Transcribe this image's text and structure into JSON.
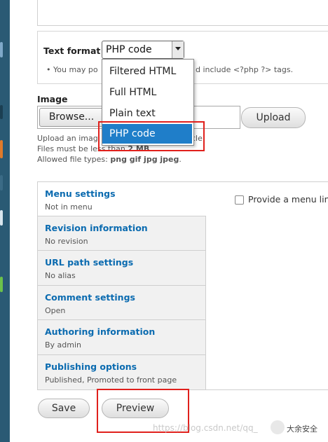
{
  "text_format": {
    "label": "Text format",
    "selected": "PHP code",
    "hint_left": "• You may po",
    "hint_right": "d include <?php ?> tags.",
    "options": [
      "Filtered HTML",
      "Full HTML",
      "Plain text",
      "PHP code"
    ]
  },
  "image": {
    "label": "Image",
    "browse_label": "Browse...",
    "upload_label": "Upload",
    "help_line1_left": "Upload an imag",
    "help_line1_right": "cle",
    "help_line2_prefix": "Files must be less than ",
    "help_line2_size": "2 MB",
    "help_line2_suffix": ".",
    "help_line3_prefix": "Allowed file types: ",
    "help_line3_types": "png gif jpg jpeg",
    "help_line3_suffix": "."
  },
  "vertical_tabs": [
    {
      "title": "Menu settings",
      "summary": "Not in menu"
    },
    {
      "title": "Revision information",
      "summary": "No revision"
    },
    {
      "title": "URL path settings",
      "summary": "No alias"
    },
    {
      "title": "Comment settings",
      "summary": "Open"
    },
    {
      "title": "Authoring information",
      "summary": "By admin"
    },
    {
      "title": "Publishing options",
      "summary": "Published, Promoted to front page"
    }
  ],
  "menu_settings_pane": {
    "checkbox_label": "Provide a menu link"
  },
  "actions": {
    "save_label": "Save",
    "preview_label": "Preview"
  },
  "watermark": {
    "url": "https://blog.csdn.net/qq_",
    "brand": "大余安全"
  },
  "colors": {
    "link": "#0b6bb0",
    "highlight_red": "#e0201c",
    "selection_blue": "#1f7ec9",
    "left_strip": "#2a5a74"
  }
}
